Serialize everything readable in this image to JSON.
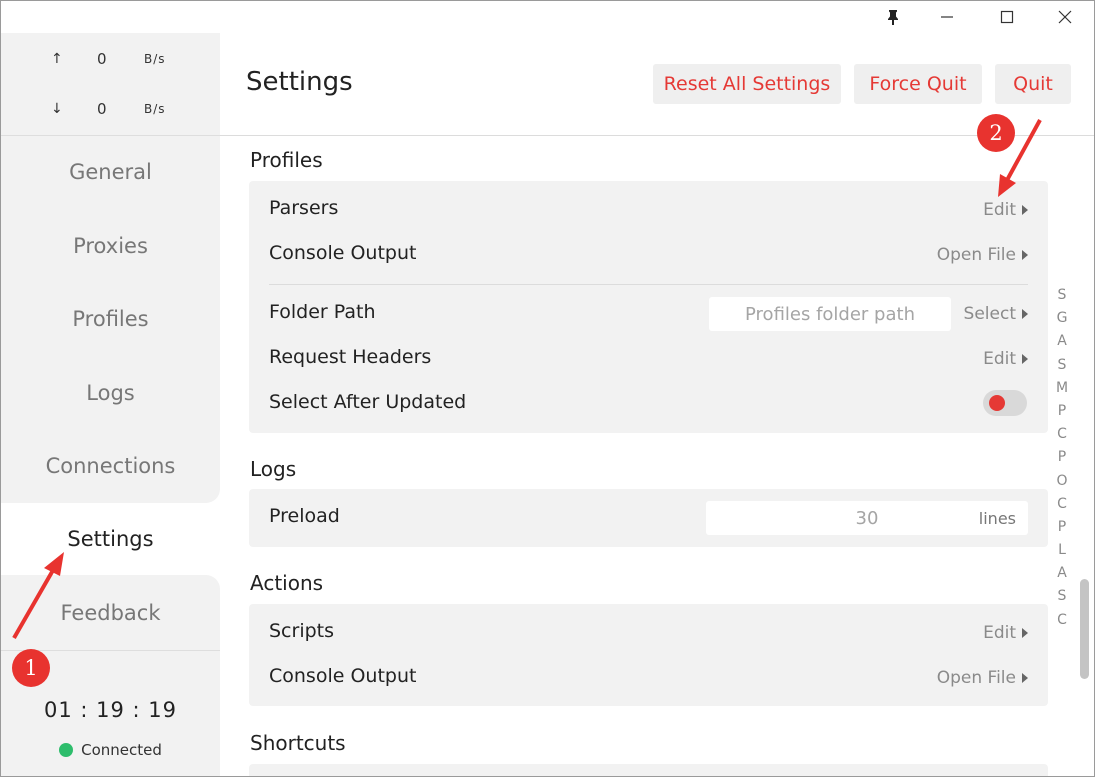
{
  "window": {
    "controls": {
      "pin": "pin-icon",
      "minimize": "minimize-icon",
      "maximize": "maximize-icon",
      "close": "close-icon"
    }
  },
  "sidebar": {
    "traffic": {
      "upload": {
        "arrow": "↑",
        "value": "0",
        "unit": "B/s"
      },
      "download": {
        "arrow": "↓",
        "value": "0",
        "unit": "B/s"
      }
    },
    "items": [
      {
        "label": "General"
      },
      {
        "label": "Proxies"
      },
      {
        "label": "Profiles"
      },
      {
        "label": "Logs"
      },
      {
        "label": "Connections"
      },
      {
        "label": "Settings",
        "active": true
      },
      {
        "label": "Feedback"
      }
    ],
    "uptime": "01 : 19 : 19",
    "status": {
      "label": "Connected",
      "color": "#2ebd6c"
    }
  },
  "header": {
    "title": "Settings",
    "buttons": {
      "reset": "Reset All Settings",
      "force_quit": "Force Quit",
      "quit": "Quit"
    },
    "accent": "#e53935"
  },
  "sections": {
    "profiles": {
      "title": "Profiles",
      "parsers": {
        "label": "Parsers",
        "action": "Edit"
      },
      "console_output": {
        "label": "Console Output",
        "action": "Open File"
      },
      "folder_path": {
        "label": "Folder Path",
        "placeholder": "Profiles folder path",
        "action": "Select"
      },
      "request_headers": {
        "label": "Request Headers",
        "action": "Edit"
      },
      "select_after_updated": {
        "label": "Select After Updated",
        "toggle_on": false
      }
    },
    "logs": {
      "title": "Logs",
      "preload": {
        "label": "Preload",
        "value": "30",
        "unit": "lines"
      }
    },
    "actions": {
      "title": "Actions",
      "scripts": {
        "label": "Scripts",
        "action": "Edit"
      },
      "console_output": {
        "label": "Console Output",
        "action": "Open File"
      }
    },
    "shortcuts": {
      "title": "Shortcuts"
    }
  },
  "index_letters": [
    "S",
    "G",
    "A",
    "S",
    "M",
    "P",
    "C",
    "P",
    "O",
    "C",
    "P",
    "L",
    "A",
    "S",
    "C"
  ],
  "annotations": {
    "badge1": "1",
    "badge2": "2",
    "color": "#e8332f"
  }
}
